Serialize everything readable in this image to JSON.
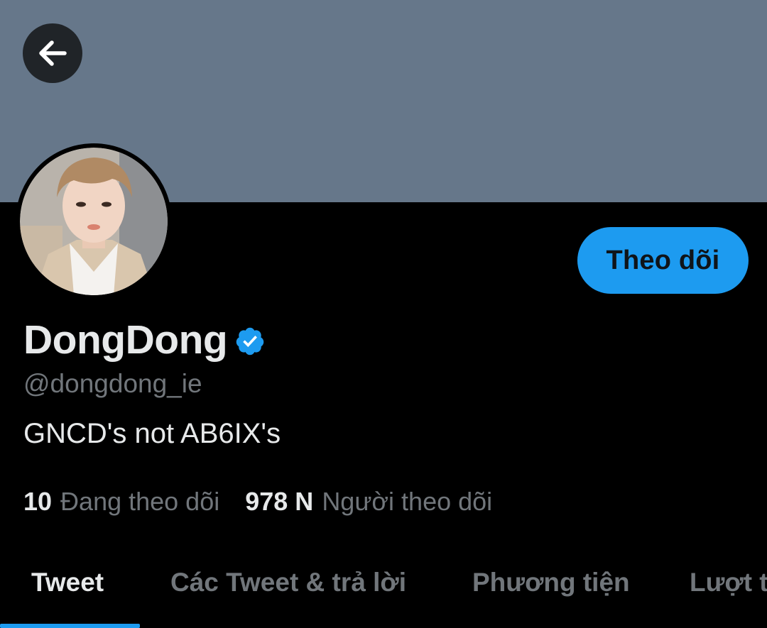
{
  "profile": {
    "display_name": "DongDong",
    "handle": "@dongdong_ie",
    "bio": "GNCD's not AB6IX's",
    "verified_icon": "verified-badge-icon",
    "follow_label": "Theo dõi"
  },
  "stats": {
    "following_count": "10",
    "following_label": "Đang theo dõi",
    "followers_count": "978 N",
    "followers_label": "Người theo dõi"
  },
  "tabs": [
    {
      "label": "Tweet",
      "active": true
    },
    {
      "label": "Các Tweet & trả lời",
      "active": false
    },
    {
      "label": "Phương tiện",
      "active": false
    },
    {
      "label": "Lượt t",
      "active": false
    }
  ],
  "icons": {
    "back": "arrow-left-icon",
    "avatar": "profile-photo"
  },
  "colors": {
    "banner": "#66778a",
    "accent": "#1d9bf0",
    "text_primary": "#e7e9ea",
    "text_secondary": "#71767b",
    "background": "#000000"
  }
}
